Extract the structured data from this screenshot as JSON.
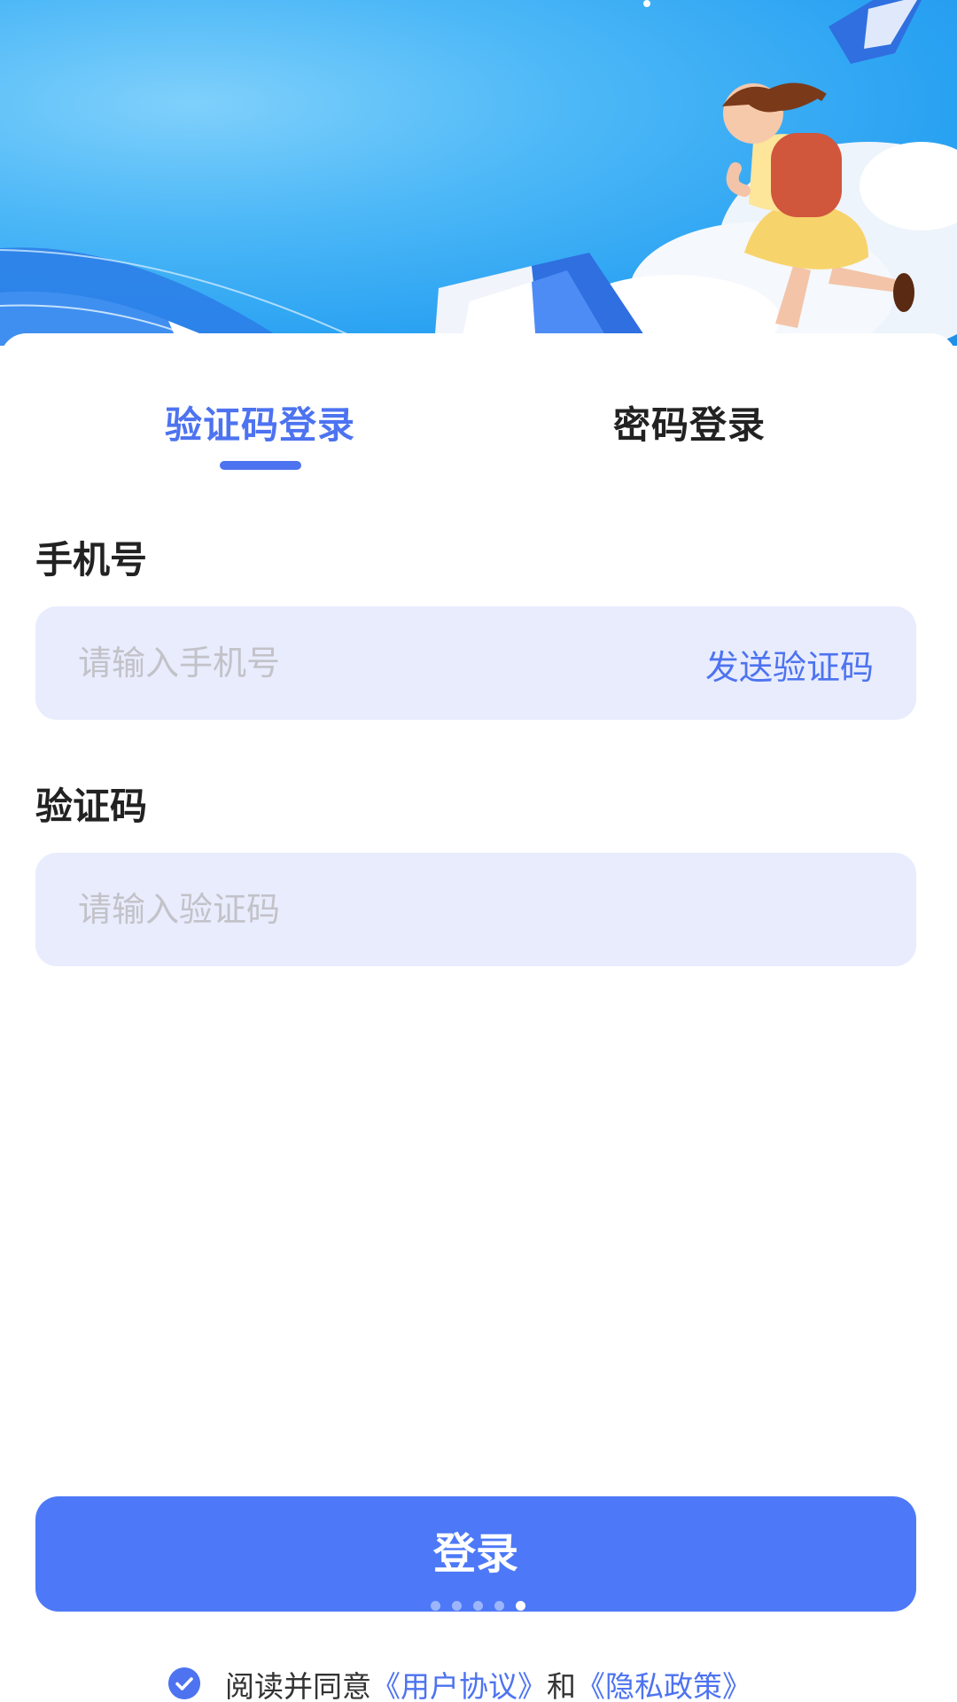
{
  "tabs": {
    "sms_login": "验证码登录",
    "password_login": "密码登录"
  },
  "form": {
    "phone_label": "手机号",
    "phone_placeholder": "请输入手机号",
    "send_code_label": "发送验证码",
    "code_label": "验证码",
    "code_placeholder": "请输入验证码"
  },
  "login_button": {
    "label": "登录",
    "page_dots": 5,
    "active_dot": 5
  },
  "agreement": {
    "prefix": "阅读并同意",
    "user_agreement": "《用户协议》",
    "conjunction": "和",
    "privacy_policy": "《隐私政策》",
    "checked": true
  },
  "colors": {
    "accent": "#4d73f0",
    "button": "#4d79f8",
    "input_bg": "#e8ecfd",
    "hero_sky": "#2aa2f2"
  },
  "icons": {
    "checkbox": "check-circle-icon",
    "header_art": "running-student-illustration"
  }
}
